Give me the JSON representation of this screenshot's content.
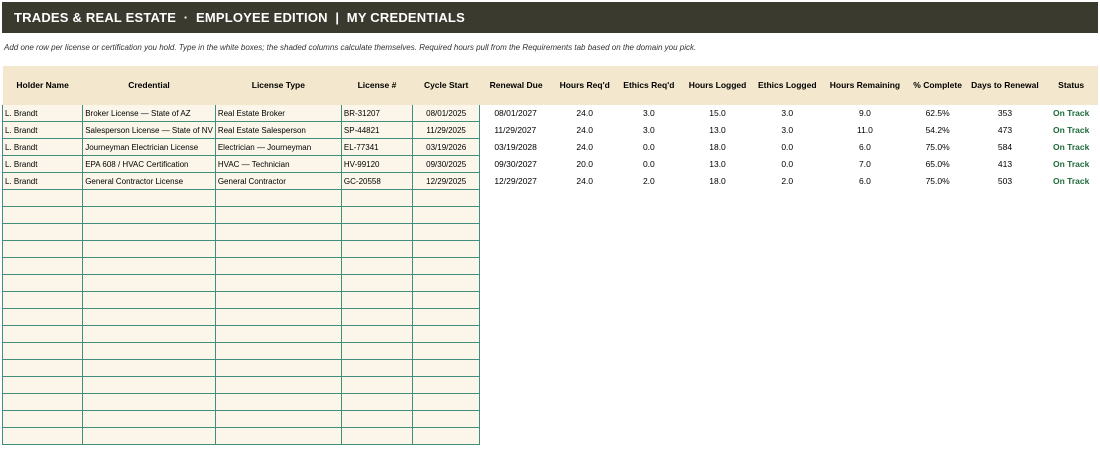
{
  "header": {
    "title": "TRADES & REAL ESTATE  ·  EMPLOYEE EDITION  |  MY CREDENTIALS"
  },
  "instructions": "Add one row per license or certification you hold. Type in the white boxes; the shaded columns calculate themselves. Required hours pull from the Requirements tab based on the domain you pick.",
  "columns": {
    "holder": "Holder Name",
    "credential": "Credential",
    "license_type": "License Type",
    "license_no": "License #",
    "cycle_start": "Cycle Start",
    "renewal_due": "Renewal Due",
    "hours_reqd": "Hours Req'd",
    "ethics_reqd": "Ethics Req'd",
    "hours_logged": "Hours Logged",
    "ethics_logged": "Ethics Logged",
    "hours_remaining": "Hours Remaining",
    "pct_complete": "% Complete",
    "days_to_renewal": "Days to Renewal",
    "status": "Status"
  },
  "rows": [
    {
      "holder": "L. Brandt",
      "credential": "Broker License — State of AZ",
      "license_type": "Real Estate Broker",
      "license_no": "BR-31207",
      "cycle_start": "08/01/2025",
      "renewal_due": "08/01/2027",
      "hours_reqd": "24.0",
      "ethics_reqd": "3.0",
      "hours_logged": "15.0",
      "ethics_logged": "3.0",
      "hours_remaining": "9.0",
      "pct_complete": "62.5%",
      "days_to_renewal": "353",
      "status": "On Track"
    },
    {
      "holder": "L. Brandt",
      "credential": "Salesperson License — State of NV",
      "license_type": "Real Estate Salesperson",
      "license_no": "SP-44821",
      "cycle_start": "11/29/2025",
      "renewal_due": "11/29/2027",
      "hours_reqd": "24.0",
      "ethics_reqd": "3.0",
      "hours_logged": "13.0",
      "ethics_logged": "3.0",
      "hours_remaining": "11.0",
      "pct_complete": "54.2%",
      "days_to_renewal": "473",
      "status": "On Track"
    },
    {
      "holder": "L. Brandt",
      "credential": "Journeyman Electrician License",
      "license_type": "Electrician — Journeyman",
      "license_no": "EL-77341",
      "cycle_start": "03/19/2026",
      "renewal_due": "03/19/2028",
      "hours_reqd": "24.0",
      "ethics_reqd": "0.0",
      "hours_logged": "18.0",
      "ethics_logged": "0.0",
      "hours_remaining": "6.0",
      "pct_complete": "75.0%",
      "days_to_renewal": "584",
      "status": "On Track"
    },
    {
      "holder": "L. Brandt",
      "credential": "EPA 608 / HVAC Certification",
      "license_type": "HVAC — Technician",
      "license_no": "HV-99120",
      "cycle_start": "09/30/2025",
      "renewal_due": "09/30/2027",
      "hours_reqd": "20.0",
      "ethics_reqd": "0.0",
      "hours_logged": "13.0",
      "ethics_logged": "0.0",
      "hours_remaining": "7.0",
      "pct_complete": "65.0%",
      "days_to_renewal": "413",
      "status": "On Track"
    },
    {
      "holder": "L. Brandt",
      "credential": "General Contractor License",
      "license_type": "General Contractor",
      "license_no": "GC-20558",
      "cycle_start": "12/29/2025",
      "renewal_due": "12/29/2027",
      "hours_reqd": "24.0",
      "ethics_reqd": "2.0",
      "hours_logged": "18.0",
      "ethics_logged": "2.0",
      "hours_remaining": "6.0",
      "pct_complete": "75.0%",
      "days_to_renewal": "503",
      "status": "On Track"
    }
  ],
  "colors": {
    "banner": "#3b3a2f",
    "header_fill": "#f3e8cd",
    "input_fill": "#fbf6e9",
    "input_border": "#3f8f7c",
    "status_ok": "#1e6b3a"
  }
}
